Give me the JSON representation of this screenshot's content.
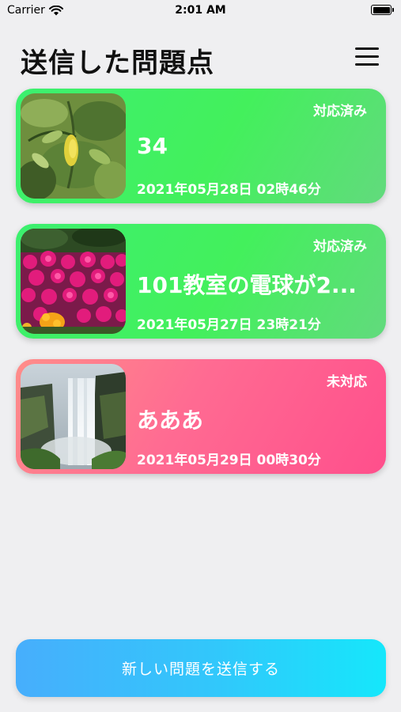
{
  "status_bar": {
    "carrier": "Carrier",
    "time": "2:01 AM",
    "wifi_icon": "wifi-icon",
    "battery_icon": "battery-icon",
    "battery_level": 1.0
  },
  "header": {
    "title": "送信した問題点",
    "menu_icon": "hamburger-menu-icon"
  },
  "colors": {
    "done_card": "#43f05c",
    "pending_card": "#ff5f8f",
    "submit_button": "#31c8fb"
  },
  "issues": [
    {
      "status": "対応済み",
      "title": "34",
      "date": "2021年05月28日 02時46分",
      "image": "lemon-tree-photo"
    },
    {
      "status": "対応済み",
      "title": "101教室の電球が2...",
      "date": "2021年05月27日 23時21分",
      "image": "pink-flowers-photo"
    },
    {
      "status": "未対応",
      "title": "あああ",
      "date": "2021年05月29日 00時30分",
      "image": "waterfall-photo"
    }
  ],
  "footer": {
    "submit_label": "新しい問題を送信する"
  }
}
